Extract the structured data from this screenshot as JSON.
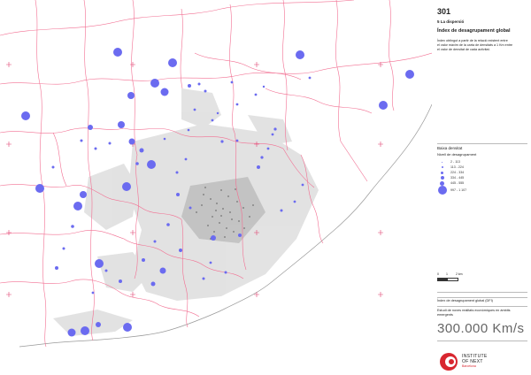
{
  "sheet": {
    "number": "301",
    "section": "5 La dispersió",
    "title": "Índex de desagrupament global",
    "description_lines": [
      "Índex obtingut a partir de la relació existent entre",
      "el valor màxim de la carta de densitats a 1 Km entre",
      "el valor de densitat de cada activitat."
    ]
  },
  "legend": {
    "group_title": "Baixa densitat",
    "subtitle": "Nivell de desagrupament",
    "items": [
      {
        "label": "2 - 113"
      },
      {
        "label": "113 - 224"
      },
      {
        "label": "224 - 334"
      },
      {
        "label": "334 - 445"
      },
      {
        "label": "445 - 555"
      },
      {
        "label": "997 - 1 107"
      }
    ],
    "point_color": "#6b6bf0"
  },
  "scale": {
    "labels": [
      "0",
      "1",
      "2 km"
    ]
  },
  "footer": {
    "index_label": "Índex de desagrupament global (DFI)",
    "study_line_1": "Estudi de noves realitats econòmiques en àmbits",
    "study_line_2": "emergents",
    "big_title": "300.000 Km/s",
    "institute_line_1": "INSTITUTE",
    "institute_line_2": "OF NEXT",
    "institute_line_3": "Barcelona"
  },
  "colors": {
    "boundary": "#f26f92",
    "built_area": "#d9d9d9",
    "points": "#6b6bf0",
    "logo_red": "#d8262f"
  }
}
